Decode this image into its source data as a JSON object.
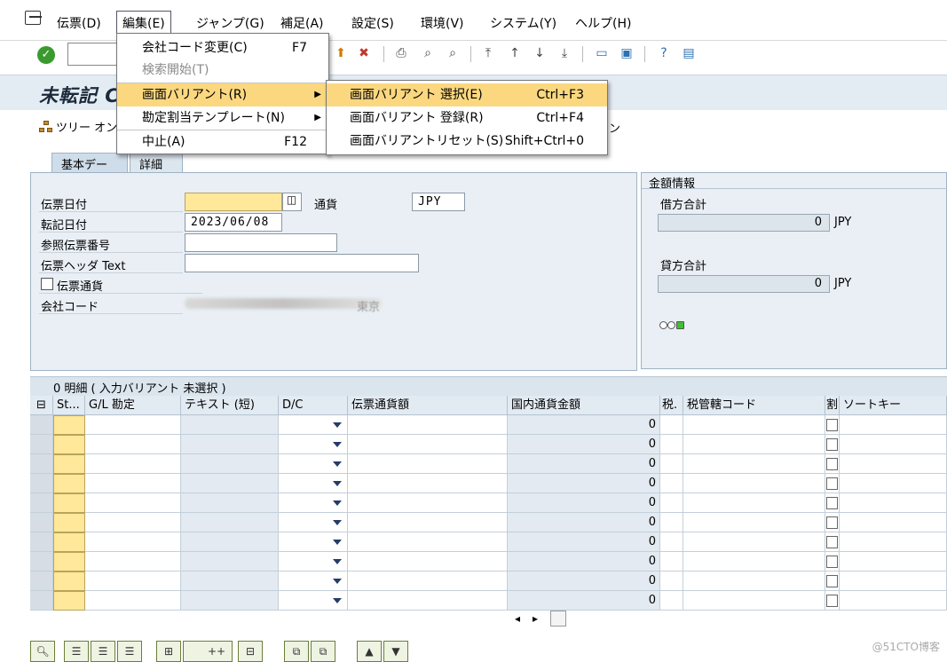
{
  "menubar": {
    "items": [
      "伝票(D)",
      "編集(E)",
      "ジャンプ(G)",
      "補足(A)",
      "設定(S)",
      "環境(V)",
      "システム(Y)",
      "ヘルプ(H)"
    ]
  },
  "edit_menu": {
    "items": [
      {
        "label": "会社コード変更(C)",
        "shortcut": "F7"
      },
      {
        "label": "検索開始(T)",
        "shortcut": ""
      },
      {
        "label": "画面バリアント(R)",
        "shortcut": "▶"
      },
      {
        "label": "勘定割当テンプレート(N)",
        "shortcut": "▶"
      },
      {
        "label": "中止(A)",
        "shortcut": "F12"
      }
    ]
  },
  "submenu": {
    "items": [
      {
        "label": "画面バリアント 選択(E)",
        "shortcut": "Ctrl+F3"
      },
      {
        "label": "画面バリアント 登録(R)",
        "shortcut": "Ctrl+F4"
      },
      {
        "label": "画面バリアントリセット(S)",
        "shortcut": "Shift+Ctrl+0"
      }
    ]
  },
  "title": {
    "text": "未転記 C",
    "hidden_suffix": "ン"
  },
  "appbar": {
    "tree_button": "ツリー オン"
  },
  "tabs": [
    "基本データ",
    "詳細"
  ],
  "header_form": {
    "doc_date_label": "伝票日付",
    "doc_date_value": "",
    "currency_label": "通貨",
    "currency_value": "JPY",
    "posting_date_label": "転記日付",
    "posting_date_value": "2023/06/08",
    "reference_label": "参照伝票番号",
    "reference_value": "",
    "header_text_label": "伝票ヘッダ Text",
    "header_text_value": "",
    "doc_currency_label": "伝票通貨",
    "company_code_label": "会社コード",
    "company_code_partial": "東京"
  },
  "amount_info": {
    "title": "金額情報",
    "debit_label": "借方合計",
    "debit_value": "0",
    "debit_currency": "JPY",
    "credit_label": "貸方合計",
    "credit_value": "0",
    "credit_currency": "JPY"
  },
  "items_table": {
    "title": "0 明細 ( 入力バリアント 未選択 )",
    "columns": [
      "St...",
      "G/L 勘定",
      "テキスト (短)",
      "D/C",
      "伝票通貨額",
      "国内通貨金額",
      "税.",
      "税管轄コード",
      "割",
      "ソートキー"
    ],
    "rows": [
      {
        "local_amount": "0"
      },
      {
        "local_amount": "0"
      },
      {
        "local_amount": "0"
      },
      {
        "local_amount": "0"
      },
      {
        "local_amount": "0"
      },
      {
        "local_amount": "0"
      },
      {
        "local_amount": "0"
      },
      {
        "local_amount": "0"
      },
      {
        "local_amount": "0"
      },
      {
        "local_amount": "0"
      }
    ]
  },
  "bottom_toolbar": {
    "plus_label": "++"
  },
  "watermark": "@51CTO博客",
  "colors": {
    "highlight": "#fbd87f",
    "required_field": "#ffe89a",
    "panel": "#e9eff5"
  }
}
